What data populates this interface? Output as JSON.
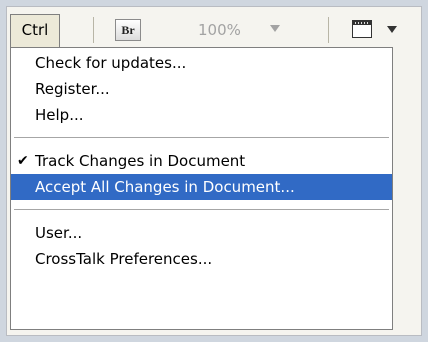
{
  "toolbar": {
    "ctrl_label": "Ctrl",
    "bridge_label": "Br",
    "zoom_value": "100%"
  },
  "menu": {
    "group1": [
      "Check for updates...",
      "Register...",
      "Help..."
    ],
    "track_changes": {
      "label": "Track Changes in Document",
      "checked": true,
      "check_mark": "✔"
    },
    "accept_all": {
      "label": "Accept All Changes in Document...",
      "highlighted": true
    },
    "group3": [
      "User...",
      "CrossTalk Preferences..."
    ]
  },
  "colors": {
    "highlight": "#316ac5",
    "menu_background": "#ffffff",
    "toolbar_background": "#f5f4ef"
  }
}
